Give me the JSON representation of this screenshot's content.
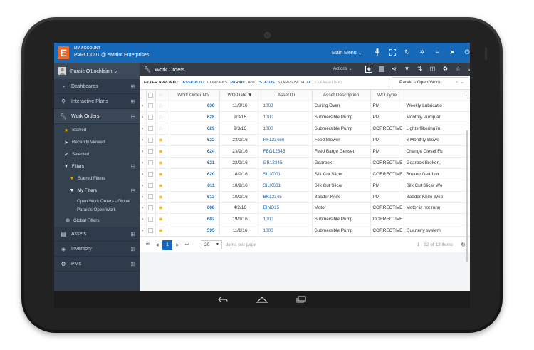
{
  "topbar": {
    "logo": "E",
    "account_label": "MY ACCOUNT",
    "account_name": "PARLOC01 @ eMaint Enterprises",
    "main_menu": "Main Menu ⌄",
    "icons": [
      "microphone-icon",
      "expand-icon",
      "refresh-icon",
      "settings-icon",
      "menu-icon",
      "location-icon",
      "power-icon"
    ]
  },
  "sidebar": {
    "user": "Paraic O'Lochlainn ⌄",
    "items": [
      {
        "label": "Dashboards",
        "icon": "dashboard-icon"
      },
      {
        "label": "Interactive Plans",
        "icon": "map-pin-icon"
      },
      {
        "label": "Work Orders",
        "icon": "wrench-icon"
      }
    ],
    "sub": {
      "starred": "Starred",
      "recently_viewed": "Recently Viewed",
      "selected": "Selected",
      "filters": "Filters",
      "starred_filters": "Starred Filters",
      "my_filters": "My Filters",
      "open_wo_global": "Open Work Orders - Global",
      "paraic_open": "Paraic's Open Work",
      "global_filters": "Global Filters"
    },
    "bottom": [
      {
        "label": "Assets",
        "icon": "assets-icon"
      },
      {
        "label": "Inventory",
        "icon": "inventory-icon"
      },
      {
        "label": "PMs",
        "icon": "pm-icon"
      }
    ]
  },
  "header": {
    "title": "Work Orders",
    "actions": "Actions ⌄"
  },
  "filter": {
    "applied": "FILTER APPLIED :",
    "k1": "ASSIGN TO",
    "op1": "CONTAINS",
    "v1": "PARAIC",
    "and": "AND",
    "k2": "STATUS",
    "op2": "STARTS WITH",
    "v2": "O",
    "clear": "(CLEAR FILTER)",
    "view": "Paraic's Open Work"
  },
  "table": {
    "columns": [
      "Work Order No",
      "WO Date ▼",
      "Asset ID",
      "Asset Description",
      "WO Type",
      "i"
    ],
    "rows": [
      {
        "no": "630",
        "date": "11/3/16",
        "asset": "1003",
        "desc": "Curing Oven",
        "type": "PM",
        "extra": "Weekly Lubricatio",
        "starred": false
      },
      {
        "no": "628",
        "date": "9/3/16",
        "asset": "1000",
        "desc": "Submersible Pump",
        "type": "PM",
        "extra": "Monthly Pump ar",
        "starred": false
      },
      {
        "no": "629",
        "date": "9/3/16",
        "asset": "1000",
        "desc": "Submersible Pump",
        "type": "CORRECTIVE",
        "extra": "Lights flikering in",
        "starred": false
      },
      {
        "no": "622",
        "date": "23/2/16",
        "asset": "RF123456",
        "desc": "Feed Blower",
        "type": "PM",
        "extra": "6 Monthly Blowe",
        "starred": true
      },
      {
        "no": "624",
        "date": "23/2/16",
        "asset": "FBG12345",
        "desc": "Feed Barge Genset",
        "type": "PM",
        "extra": "Change Diesel Fu",
        "starred": true
      },
      {
        "no": "621",
        "date": "22/2/16",
        "asset": "GB12345",
        "desc": "Gearbox",
        "type": "CORRECTIVE",
        "extra": "Gearbox Broken,",
        "starred": true
      },
      {
        "no": "620",
        "date": "18/2/16",
        "asset": "SILK001",
        "desc": "Silk Cut Slicer",
        "type": "CORRECTIVE",
        "extra": "Broken Gearbox",
        "starred": true
      },
      {
        "no": "611",
        "date": "10/2/16",
        "asset": "SILK001",
        "desc": "Silk Cut Slicer",
        "type": "PM",
        "extra": "Silk Cut Slicer We",
        "starred": true
      },
      {
        "no": "613",
        "date": "10/2/16",
        "asset": "BK12345",
        "desc": "Baader Knife",
        "type": "PM",
        "extra": "Baader Knife Wee",
        "starred": true
      },
      {
        "no": "608",
        "date": "4/2/16",
        "asset": "EINO15",
        "desc": "Motor",
        "type": "CORRECTIVE",
        "extra": "Motor is not runn",
        "starred": true
      },
      {
        "no": "602",
        "date": "19/1/16",
        "asset": "1000",
        "desc": "Submersible Pump",
        "type": "CORRECTIVE",
        "extra": "",
        "starred": true
      },
      {
        "no": "595",
        "date": "11/1/16",
        "asset": "1000",
        "desc": "Submersible Pump",
        "type": "CORRECTIVE",
        "extra": "Quarterly system",
        "starred": true
      }
    ]
  },
  "pager": {
    "current": "1",
    "page_size": "20",
    "per_page_label": "items per page",
    "info": "1 - 12 of 12 items"
  }
}
